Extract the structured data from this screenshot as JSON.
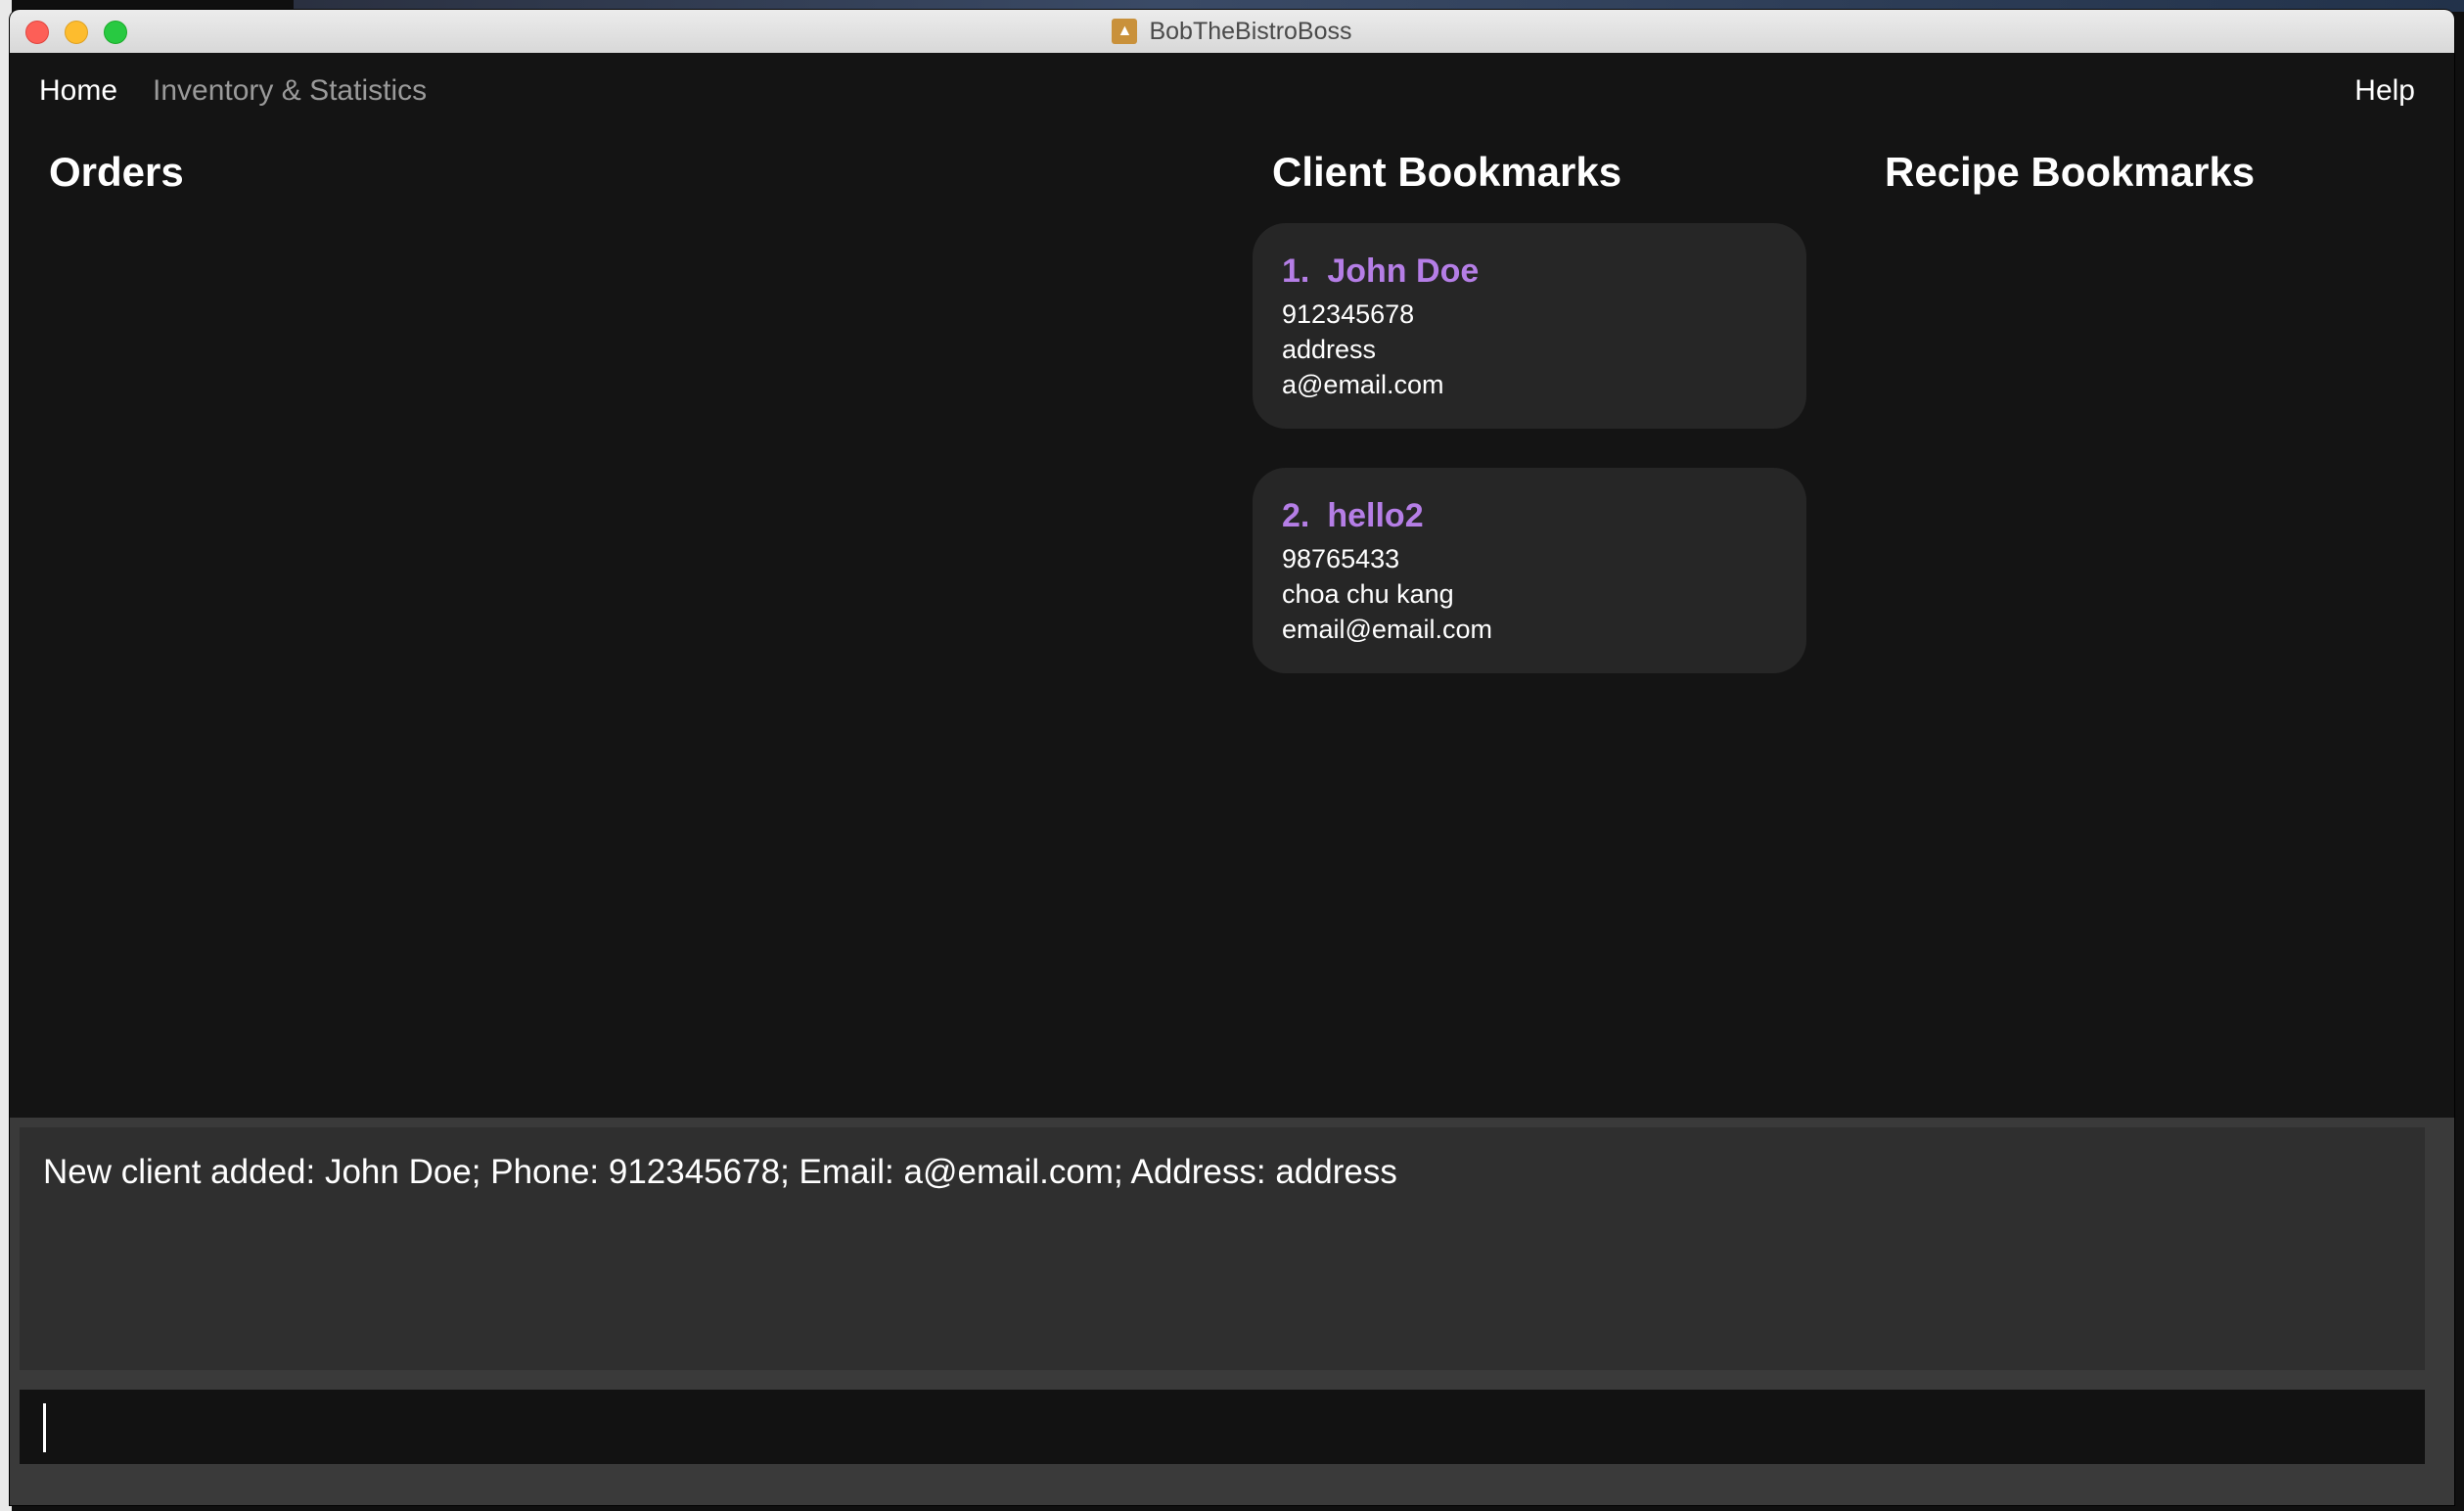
{
  "window": {
    "title": "BobTheBistroBoss"
  },
  "menu": {
    "home": "Home",
    "inventory": "Inventory & Statistics",
    "help": "Help"
  },
  "panels": {
    "orders_title": "Orders",
    "client_title": "Client Bookmarks",
    "recipe_title": "Recipe Bookmarks"
  },
  "clients": [
    {
      "index": "1.",
      "name": "John Doe",
      "phone": "912345678",
      "address": "address",
      "email": "a@email.com"
    },
    {
      "index": "2.",
      "name": "hello2",
      "phone": "98765433",
      "address": "choa chu kang",
      "email": "email@email.com"
    }
  ],
  "result": {
    "message": "New client added: John Doe; Phone: 912345678; Email: a@email.com; Address: address"
  },
  "command": {
    "value": ""
  },
  "colors": {
    "accent": "#b57ee6",
    "background": "#141414",
    "card": "#262626"
  }
}
